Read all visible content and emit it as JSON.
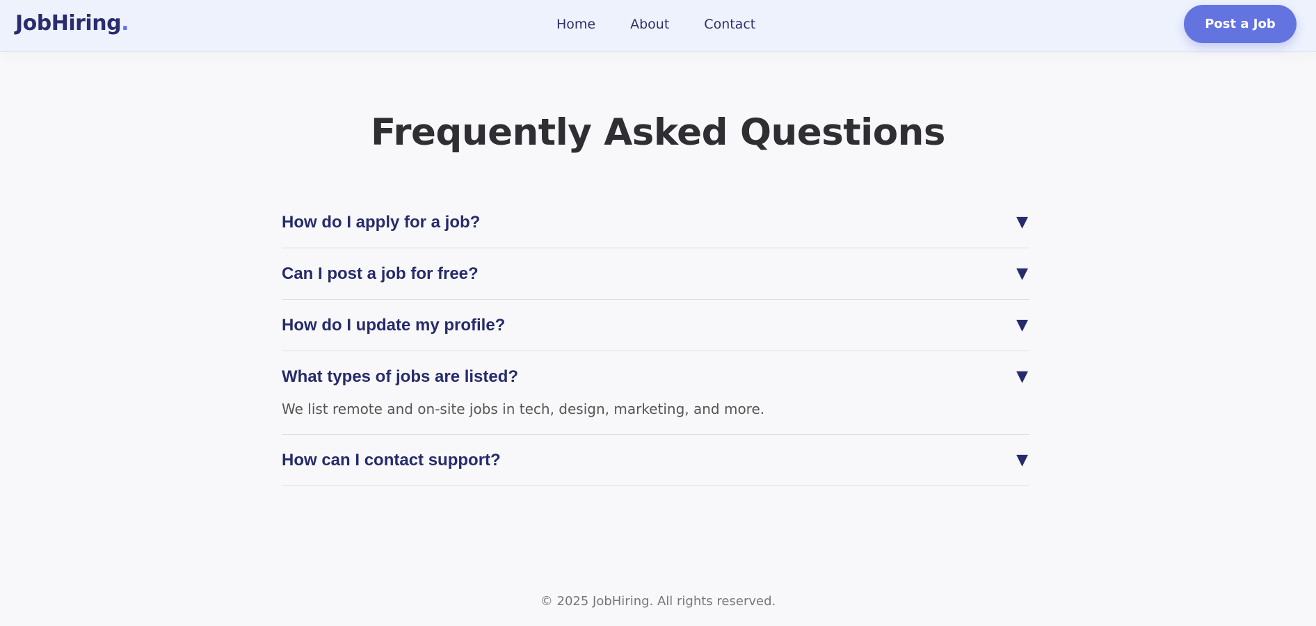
{
  "header": {
    "logo_text": "JobHiring",
    "logo_dot": ".",
    "nav": [
      "Home",
      "About",
      "Contact"
    ],
    "cta_label": "Post a Job"
  },
  "main": {
    "title": "Frequently Asked Questions",
    "faqs": [
      {
        "question": "How do I apply for a job?",
        "answer": "",
        "open": false
      },
      {
        "question": "Can I post a job for free?",
        "answer": "",
        "open": false
      },
      {
        "question": "How do I update my profile?",
        "answer": "",
        "open": false
      },
      {
        "question": "What types of jobs are listed?",
        "answer": "We list remote and on-site jobs in tech, design, marketing, and more.",
        "open": true
      },
      {
        "question": "How can I contact support?",
        "answer": "",
        "open": false
      }
    ],
    "toggle_glyph": "▼"
  },
  "footer": {
    "text": "© 2025 JobHiring. All rights reserved."
  },
  "colors": {
    "brand": "#2b2c6e",
    "accent": "#6374e1",
    "heading": "#262b6c"
  },
  "icons": {
    "faq_toggle": "chevron-down-icon"
  }
}
